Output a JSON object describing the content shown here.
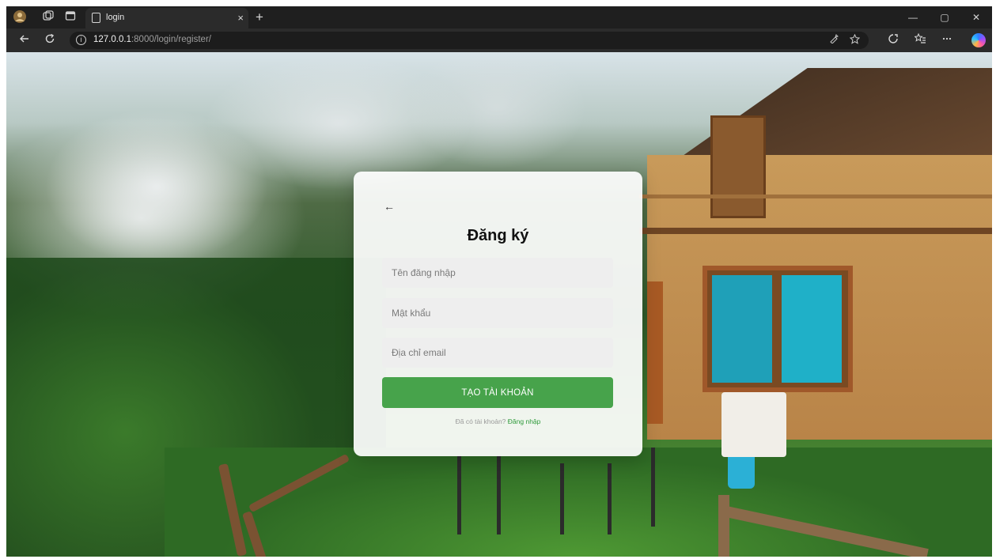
{
  "browser": {
    "tab_title": "login",
    "tab_close_glyph": "×",
    "new_tab_glyph": "+",
    "url_host": "127.0.0.1",
    "url_path": ":8000/login/register/",
    "icons": {
      "profile": "profile-avatar-icon",
      "workspaces": "workspaces-icon",
      "tab_actions": "tab-actions-icon",
      "back": "back-arrow-icon",
      "reload": "reload-icon",
      "info": "info-icon",
      "read_aloud": "read-aloud-icon",
      "favorite": "star-icon",
      "extensions": "extensions-icon",
      "favorites_bar": "favorites-icon",
      "more": "more-icon",
      "copilot": "copilot-icon"
    },
    "window_controls": {
      "minimize": "—",
      "maximize": "▢",
      "close": "✕"
    }
  },
  "form": {
    "back_glyph": "←",
    "title": "Đăng ký",
    "username_placeholder": "Tên đăng nhập",
    "password_placeholder": "Mật khẩu",
    "email_placeholder": "Địa chỉ email",
    "submit_label": "TẠO TÀI KHOẢN",
    "login_prompt_text": "Đã có tài khoản?",
    "login_link_text": "Đăng nhập"
  },
  "colors": {
    "primary_button": "#47a34b",
    "link": "#2e9a3a",
    "browser_chrome": "#1f1f1f"
  }
}
